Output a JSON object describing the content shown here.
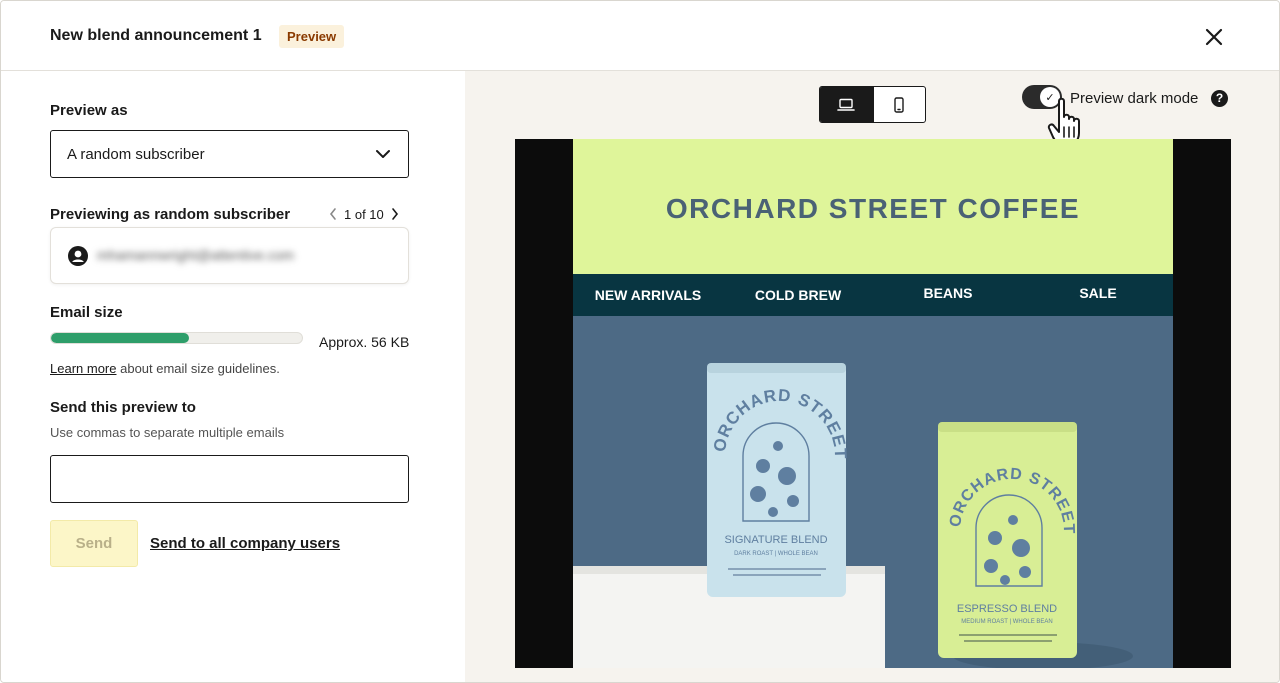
{
  "header": {
    "title": "New blend announcement 1",
    "badge": "Preview"
  },
  "left": {
    "preview_as_label": "Preview as",
    "preview_as_value": "A random subscriber",
    "previewing_label": "Previewing as random subscriber",
    "pager": {
      "current": "1 of 10"
    },
    "subscriber_email": "mhamannwright@attentive.com",
    "email_size_label": "Email size",
    "email_size_fraction": 0.55,
    "email_size_text": "Approx. 56 KB",
    "learn_more": "Learn more",
    "learn_more_suffix": "about email size guidelines.",
    "send_label": "Send this preview to",
    "send_hint": "Use commas to separate multiple emails",
    "send_input_value": "",
    "send_button": "Send",
    "send_all_link": "Send to all company users"
  },
  "right": {
    "dark_mode_label": "Preview dark mode",
    "dark_mode_on": true,
    "device_active": "desktop",
    "help_glyph": "?",
    "email": {
      "brand": "ORCHARD STREET COFFEE",
      "nav": [
        "NEW ARRIVALS",
        "COLD BREW",
        "BEANS",
        "SALE"
      ],
      "bag_left": {
        "brand_arc": "ORCHARD STREET COFFEE",
        "name": "SIGNATURE BLEND",
        "roast": "DARK ROAST | WHOLE BEAN"
      },
      "bag_right": {
        "brand_arc": "ORCHARD STREET COFFEE",
        "name": "ESPRESSO BLEND",
        "roast": "MEDIUM ROAST | WHOLE BEAN"
      }
    }
  },
  "colors": {
    "accent_green": "#2e9e6a",
    "banner": "#dff59a",
    "nav_bg": "#083541",
    "hero_bg": "#4d6a85",
    "badge_text": "#8a3a00",
    "badge_bg": "#fbf1dc"
  },
  "icons": {
    "close": "close-icon",
    "chevron": "chevron-down-icon",
    "prev": "chevron-left-icon",
    "next": "chevron-right-icon",
    "avatar": "user-circle-icon",
    "desktop": "laptop-icon",
    "mobile": "phone-icon",
    "help": "question-icon",
    "cursor": "pointer-hand-icon"
  }
}
